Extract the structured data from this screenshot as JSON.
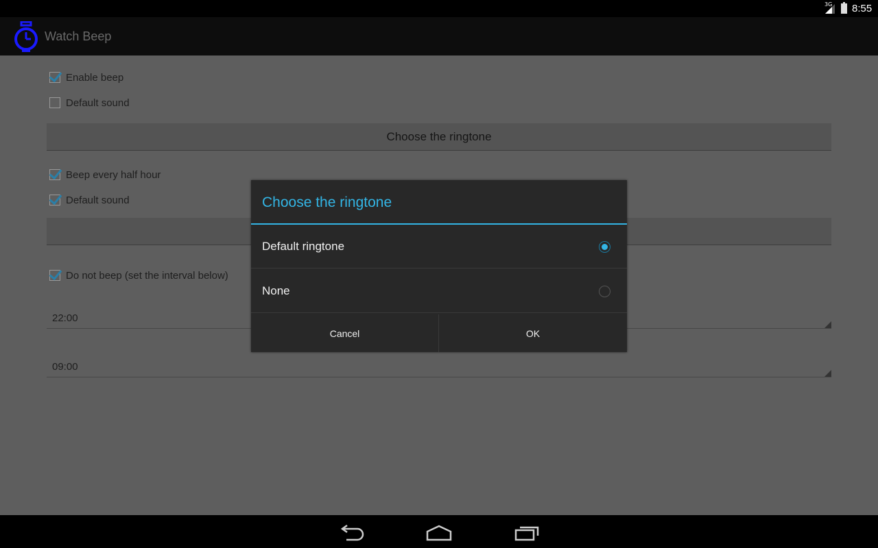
{
  "status_bar": {
    "network_type": "3G",
    "time": "8:55",
    "icons": [
      "signal-icon",
      "battery-icon"
    ]
  },
  "action_bar": {
    "app_icon": "stopwatch-icon",
    "title": "Watch Beep",
    "icon_color": "#1a1aff"
  },
  "settings": {
    "enable_beep": {
      "label": "Enable beep",
      "checked": true
    },
    "default_sound_1": {
      "label": "Default sound",
      "checked": false
    },
    "choose_ringtone_button": {
      "label": "Choose the ringtone"
    },
    "beep_half_hour": {
      "label": "Beep every half hour",
      "checked": true
    },
    "default_sound_2": {
      "label": "Default sound",
      "checked": true
    },
    "do_not_beep": {
      "label": "Do not beep (set the interval below)",
      "checked": true
    },
    "from_time": {
      "value": "22:00"
    },
    "to_time": {
      "value": "09:00"
    }
  },
  "dialog": {
    "title": "Choose the ringtone",
    "accent_color": "#33b5e5",
    "options": [
      {
        "label": "Default ringtone",
        "selected": true
      },
      {
        "label": "None",
        "selected": false
      }
    ],
    "cancel_label": "Cancel",
    "ok_label": "OK"
  },
  "nav_bar": {
    "buttons": [
      "back-icon",
      "home-icon",
      "recent-apps-icon"
    ]
  }
}
